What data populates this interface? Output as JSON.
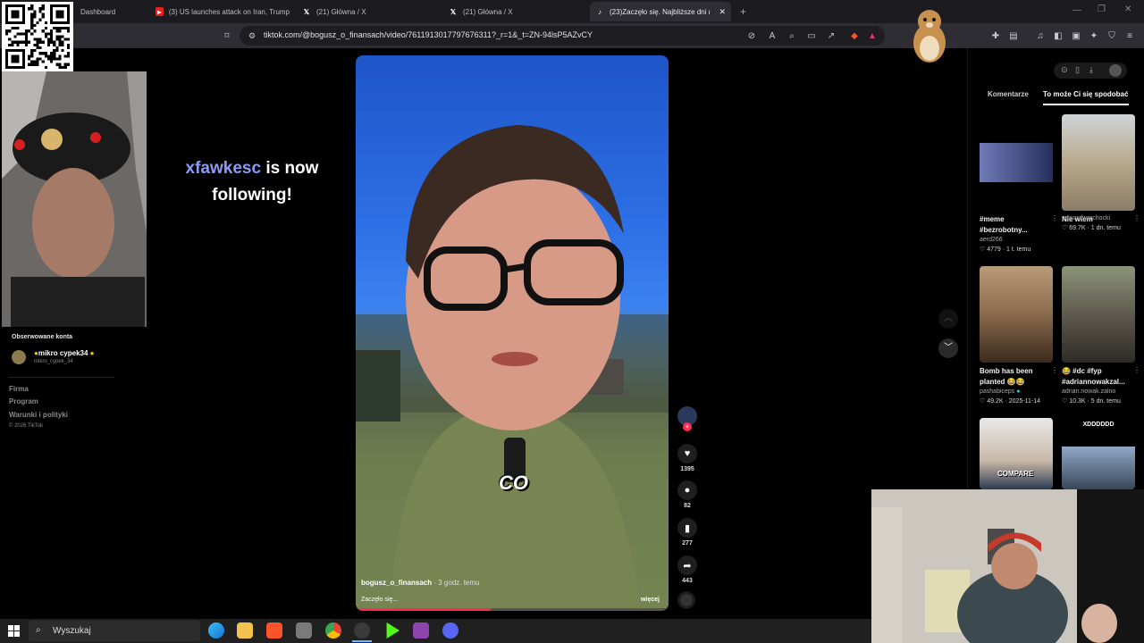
{
  "browser": {
    "tabs": [
      {
        "label": "Dashboard",
        "icon": "dashboard-icon"
      },
      {
        "label": "(3) US launches attack on Iran, Trump",
        "icon": "youtube-icon"
      },
      {
        "label": "(21) Główna / X",
        "icon": "x-icon"
      },
      {
        "label": "(21) Główna / X",
        "icon": "x-icon"
      },
      {
        "label": "(23)Zaczęło się. Najbliższe dni m",
        "icon": "tiktok-icon",
        "active": true
      }
    ],
    "url": "tiktok.com/@bogusz_o_finansach/video/7611913017797676311?_r=1&_t=ZN-94lsP5AZvCY"
  },
  "sidebar": {
    "following_header": "Obserwowane konta",
    "followed_account": {
      "name": "mikro cypek34",
      "handle": "mikro_cypek_34"
    },
    "links": [
      "Firma",
      "Program",
      "Warunki i polityki"
    ],
    "copyright": "© 2026 TikTok"
  },
  "follow_alert": {
    "username": "xfawkesc",
    "text_1": "is now",
    "text_2": "following!"
  },
  "video": {
    "author": "bogusz_o_finansach",
    "posted": "· 3 godz. temu",
    "caption": "Zaczęło się...",
    "more_label": "więcej",
    "overlay_word": "CO",
    "progress": 0.43
  },
  "actions": {
    "likes": "1395",
    "comments": "82",
    "saves": "277",
    "shares": "443"
  },
  "right_panel": {
    "tab_comments": "Komentarze",
    "tab_recommended": "To może Ci się spodobać",
    "cards": [
      {
        "title_1": "#meme",
        "title_2": "#bezrobotny...",
        "author": "aerd266",
        "likes": "4779",
        "age": "1 t. temu"
      },
      {
        "title_1": "Nie wiem",
        "title_2": "",
        "author": "edwardwarchocki",
        "likes": "69.7K",
        "age": "1 dn. temu"
      },
      {
        "title_1": "Bomb has been",
        "title_2": "planted 😂😂",
        "author": "pashabiceps",
        "likes": "49.2K",
        "age": "2025-11-14"
      },
      {
        "title_1": "😂 #dc #fyp",
        "title_2": "#adriannowakzal...",
        "author": "adrian.nowak.zalno",
        "likes": "10.3K",
        "age": "5 dn. temu"
      },
      {
        "title_1": "",
        "title_2": "",
        "author": "",
        "likes": "",
        "age": "",
        "overlay": "COMPARE"
      },
      {
        "title_1": "",
        "title_2": "",
        "author": "",
        "likes": "",
        "age": "",
        "overlay": "XDDDDDD"
      }
    ]
  },
  "taskbar": {
    "search_placeholder": "Wyszukaj"
  },
  "colors": {
    "accent": "#fe2c55",
    "follow_name": "#8a9cf5",
    "link_gray": "#8a8a8a"
  }
}
